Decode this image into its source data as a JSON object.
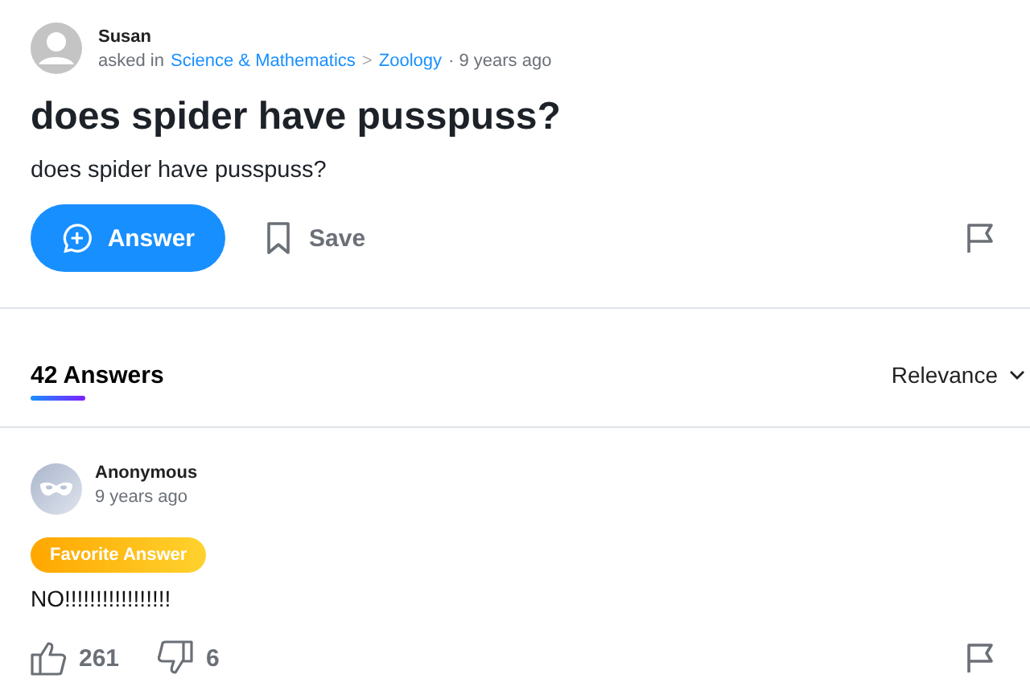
{
  "question": {
    "author": "Susan",
    "asked_in": "asked in",
    "category": "Science & Mathematics",
    "separator": ">",
    "subcategory": "Zoology",
    "time": "· 9 years ago",
    "title": "does spider have pusspuss?",
    "body": "does spider have pusspuss?"
  },
  "actions": {
    "answer": "Answer",
    "save": "Save"
  },
  "answers_header": {
    "count": "42 Answers",
    "sort": "Relevance"
  },
  "answers": [
    {
      "author": "Anonymous",
      "time": "9 years ago",
      "favorite": true,
      "badge": "Favorite Answer",
      "text": "NO!!!!!!!!!!!!!!!!!",
      "upvotes": "261",
      "downvotes": "6"
    }
  ]
}
